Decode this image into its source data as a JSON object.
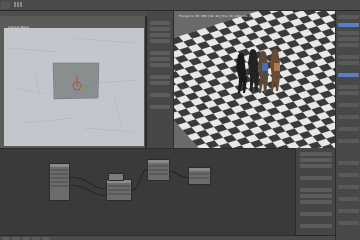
{
  "clip_editor": {
    "label": "Camera Move"
  },
  "viewport": {
    "header_text": "Frame:11 | Bl: 188 | Ve: 16 | Tris: 16 | Objects: 1/5"
  },
  "colors": {
    "background": "#3d3d3d",
    "checker_light": "#e8e8e8",
    "checker_dark": "#3a3a3a",
    "footage_bg": "#c9cbd1",
    "marker_red": "#c83a3a",
    "axis_green": "#3ab34a"
  },
  "icons": [
    "cursor-icon",
    "toolbar-icons",
    "node-link-icon"
  ]
}
